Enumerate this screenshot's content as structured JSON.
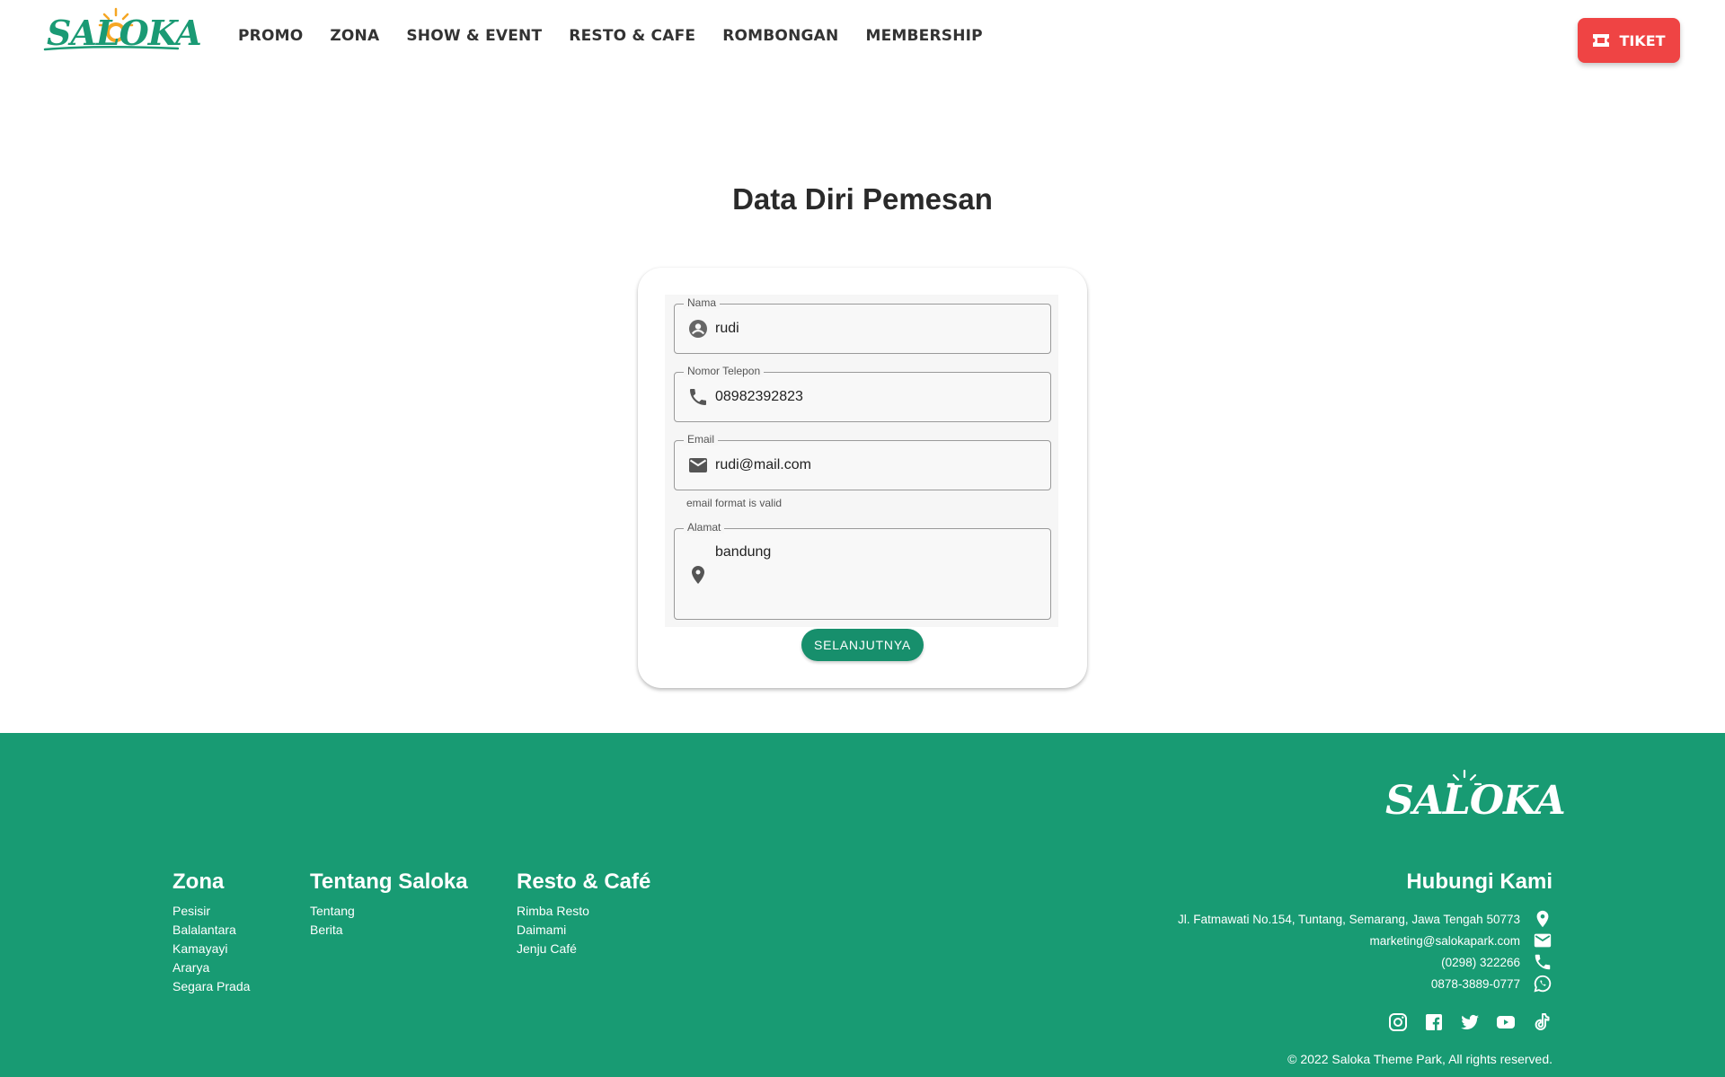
{
  "header": {
    "logo_text": "SALOKA",
    "nav": [
      "PROMO",
      "ZONA",
      "SHOW & EVENT",
      "RESTO & CAFE",
      "ROMBONGAN",
      "MEMBERSHIP"
    ],
    "ticket_label": "TIKET",
    "accent_color": "#ef4444"
  },
  "main": {
    "title": "Data Diri Pemesan",
    "fields": {
      "nama": {
        "label": "Nama",
        "value": "rudi",
        "icon": "account-circle-icon"
      },
      "telepon": {
        "label": "Nomor Telepon",
        "value": "08982392823",
        "icon": "phone-icon"
      },
      "email": {
        "label": "Email",
        "value": "rudi@mail.com",
        "icon": "mail-icon",
        "helper": "email format is valid"
      },
      "alamat": {
        "label": "Alamat",
        "value": "bandung",
        "icon": "location-pin-icon"
      }
    },
    "next_button": "SELANJUTNYA",
    "brand_color": "#178f6c"
  },
  "footer": {
    "logo_text": "SALOKA",
    "bg_color": "#189b73",
    "zona": {
      "title": "Zona",
      "links": [
        "Pesisir",
        "Balalantara",
        "Kamayayi",
        "Ararya",
        "Segara Prada"
      ]
    },
    "tentang": {
      "title": "Tentang Saloka",
      "links": [
        "Tentang",
        "Berita"
      ]
    },
    "resto": {
      "title": "Resto & Café",
      "links": [
        "Rimba Resto",
        "Daimami",
        "Jenju Café"
      ]
    },
    "contact": {
      "title": "Hubungi Kami",
      "address": "Jl. Fatmawati No.154, Tuntang, Semarang, Jawa Tengah 50773",
      "email": "marketing@salokapark.com",
      "phone": "(0298) 322266",
      "whatsapp": "0878-3889-0777"
    },
    "social_icons": [
      "instagram-icon",
      "facebook-icon",
      "twitter-icon",
      "youtube-icon",
      "tiktok-icon"
    ],
    "copyright": "© 2022 Saloka Theme Park, All rights reserved."
  }
}
